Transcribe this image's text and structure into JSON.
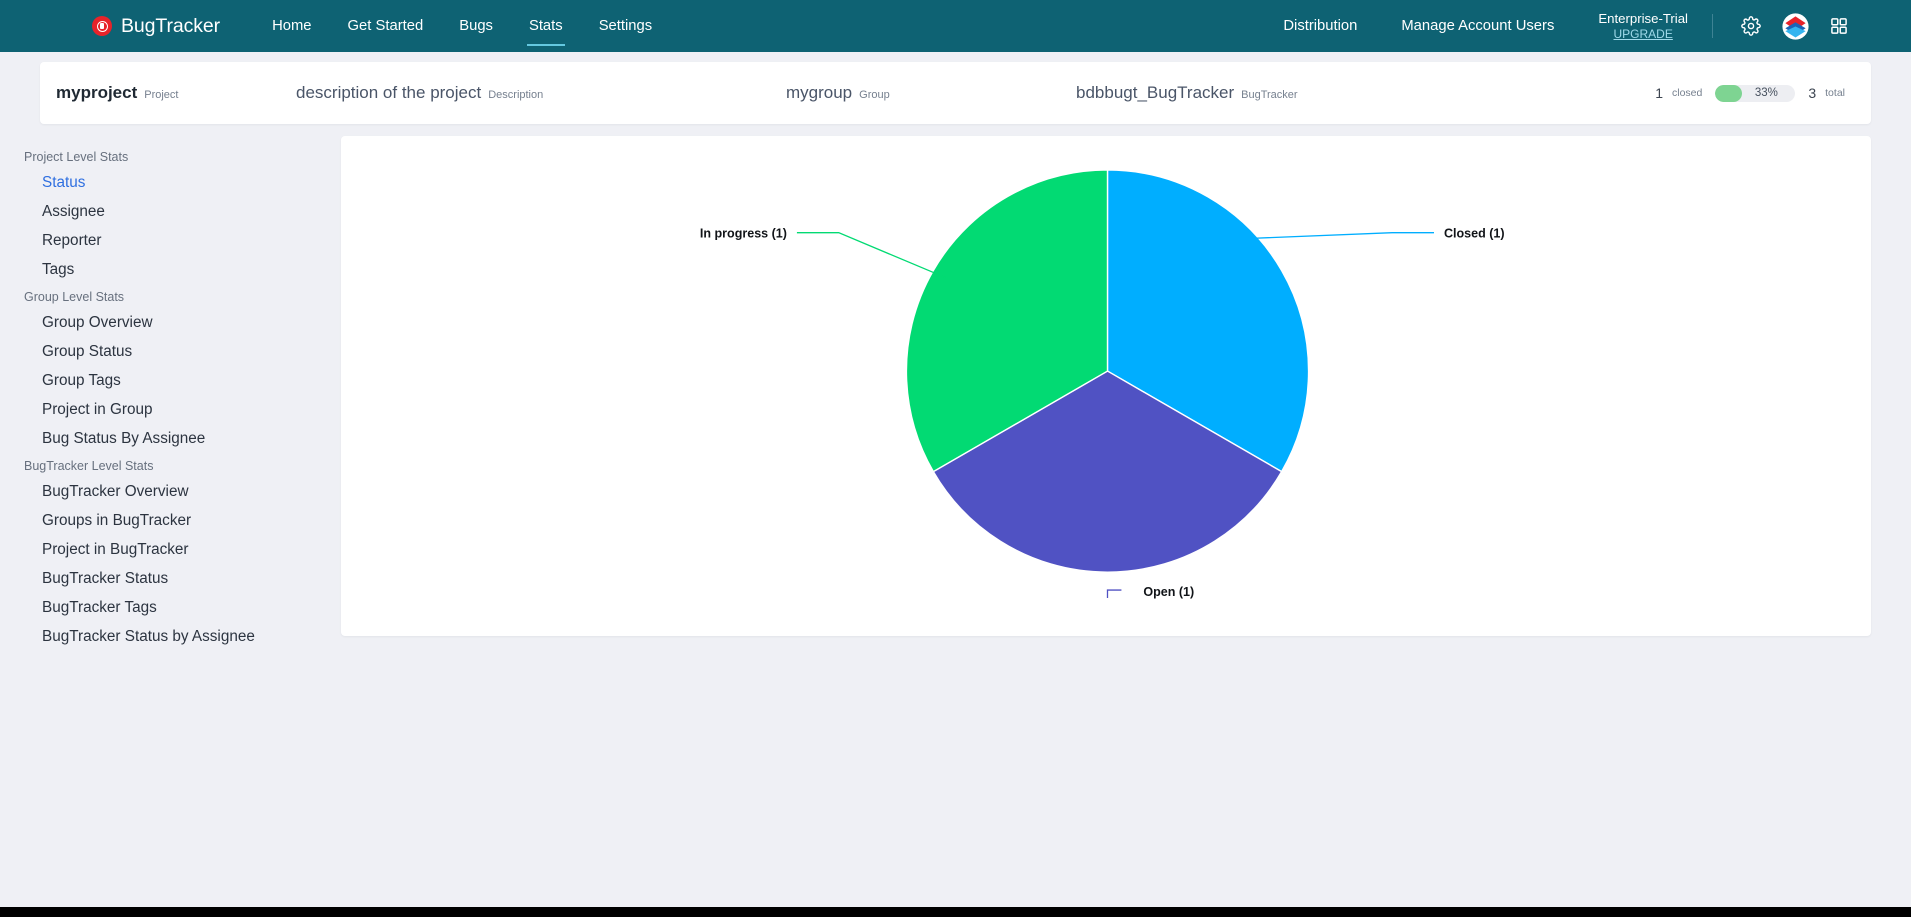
{
  "navbar": {
    "brand": "BugTracker",
    "brand_logo_icon": "record-circle-icon",
    "links": [
      {
        "label": "Home",
        "active": false
      },
      {
        "label": "Get Started",
        "active": false
      },
      {
        "label": "Bugs",
        "active": false
      },
      {
        "label": "Stats",
        "active": true
      },
      {
        "label": "Settings",
        "active": false
      }
    ],
    "right_links": [
      {
        "label": "Distribution"
      },
      {
        "label": "Manage Account Users"
      }
    ],
    "trial_label": "Enterprise-Trial",
    "upgrade_label": "UPGRADE",
    "gear_icon": "gear-icon",
    "account_logo_icon": "account-logo-icon",
    "apps_icon": "apps-grid-icon",
    "background_color": "#0e6273",
    "active_underline_color": "#64c8e0"
  },
  "info_bar": {
    "project": {
      "value": "myproject",
      "label": "Project"
    },
    "description": {
      "value": "description of the project",
      "label": "Description"
    },
    "group": {
      "value": "mygroup",
      "label": "Group"
    },
    "bugtracker": {
      "value": "bdbbugt_BugTracker",
      "label": "BugTracker"
    },
    "progress": {
      "closed_count": "1",
      "closed_label": "closed",
      "percent_text": "33%",
      "percent_value": 33,
      "total_count": "3",
      "total_label": "total",
      "fill_color": "#7ed492"
    }
  },
  "sidebar": {
    "sections": [
      {
        "title": "Project Level Stats",
        "items": [
          {
            "label": "Status",
            "active": true
          },
          {
            "label": "Assignee",
            "active": false
          },
          {
            "label": "Reporter",
            "active": false
          },
          {
            "label": "Tags",
            "active": false
          }
        ]
      },
      {
        "title": "Group Level Stats",
        "items": [
          {
            "label": "Group Overview",
            "active": false
          },
          {
            "label": "Group Status",
            "active": false
          },
          {
            "label": "Group Tags",
            "active": false
          },
          {
            "label": "Project in Group",
            "active": false
          },
          {
            "label": "Bug Status By Assignee",
            "active": false
          }
        ]
      },
      {
        "title": "BugTracker Level Stats",
        "items": [
          {
            "label": "BugTracker Overview",
            "active": false
          },
          {
            "label": "Groups in BugTracker",
            "active": false
          },
          {
            "label": "Project in BugTracker",
            "active": false
          },
          {
            "label": "BugTracker Status",
            "active": false
          },
          {
            "label": "BugTracker Tags",
            "active": false
          },
          {
            "label": "BugTracker Status by Assignee",
            "active": false
          }
        ]
      }
    ]
  },
  "chart_data": {
    "type": "pie",
    "title": "",
    "labels": [
      "Closed (1)",
      "Open (1)",
      "In progress (1)"
    ],
    "categories": [
      "Closed",
      "Open",
      "In progress"
    ],
    "values": [
      1,
      1,
      1
    ],
    "percentages": [
      33.3,
      33.3,
      33.3
    ],
    "colors": [
      "#00aeff",
      "#5052c3",
      "#02da73"
    ],
    "legend": "none",
    "grid": false,
    "start_angle_deg": 0,
    "direction": "clockwise",
    "slices": [
      {
        "label": "Closed (1)",
        "value": 1,
        "color": "#00aeff",
        "start_deg": 0,
        "end_deg": 120
      },
      {
        "label": "Open (1)",
        "value": 1,
        "color": "#5052c3",
        "start_deg": 120,
        "end_deg": 240
      },
      {
        "label": "In progress (1)",
        "value": 1,
        "color": "#02da73",
        "start_deg": 240,
        "end_deg": 360
      }
    ]
  }
}
